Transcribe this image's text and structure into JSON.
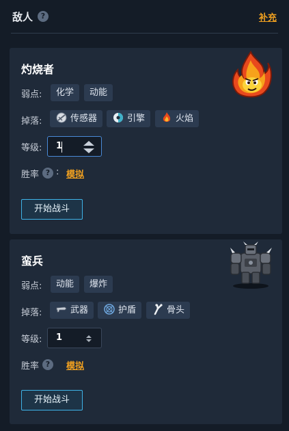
{
  "header": {
    "title": "敌人",
    "help_glyph": "?",
    "link": "补充"
  },
  "enemies": [
    {
      "name": "灼烧者",
      "image": "fire-creature",
      "weakness_label": "弱点:",
      "weaknesses": [
        "化学",
        "动能"
      ],
      "drops_label": "掉落:",
      "drops": [
        {
          "icon": "sensor-icon",
          "label": "传感器"
        },
        {
          "icon": "engine-icon",
          "label": "引擎"
        },
        {
          "icon": "flame-icon",
          "label": "火焰"
        }
      ],
      "level_label": "等级:",
      "level": "1",
      "winrate_label": "胜率",
      "winrate_colon": ":",
      "simulate_link": "模拟",
      "start_button": "开始战斗"
    },
    {
      "name": "蛮兵",
      "image": "armored-brute",
      "weakness_label": "弱点:",
      "weaknesses": [
        "动能",
        "爆炸"
      ],
      "drops_label": "掉落:",
      "drops": [
        {
          "icon": "weapon-icon",
          "label": "武器"
        },
        {
          "icon": "shield-icon",
          "label": "护盾"
        },
        {
          "icon": "bone-icon",
          "label": "骨头"
        }
      ],
      "level_label": "等级:",
      "level": "1",
      "winrate_label": "胜率",
      "winrate_colon": ":",
      "simulate_link": "模拟",
      "start_button": "开始战斗"
    }
  ],
  "colors": {
    "background": "#141c27",
    "card": "#1f2a39",
    "tag": "#2c3b50",
    "link": "#f0a020",
    "button_border": "#3fb4e8",
    "focus_border": "#4a8bd8"
  }
}
